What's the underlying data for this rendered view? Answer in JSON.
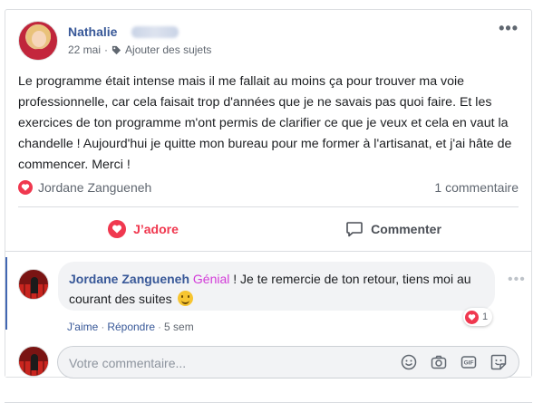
{
  "post": {
    "author": "Nathalie",
    "date": "22 mai",
    "separator": "·",
    "add_topics": "Ajouter des sujets",
    "more_icon": "more-horizontal-icon",
    "text": "Le programme était intense mais il me fallait au moins ça pour trouver ma voie professionnelle, car cela faisait trop d'années que je ne savais pas quoi faire. Et les exercices de ton programme m'ont permis de clarifier ce que je veux et cela en vaut la chandelle ! Aujourd'hui je quitte mon bureau pour me former à l'artisanat, et j'ai hâte de commencer. Merci !"
  },
  "reactions": {
    "icon": "love-reaction-icon",
    "names": "Jordane Zangueneh",
    "comment_count": "1 commentaire"
  },
  "actions": {
    "love_label": "J’adore",
    "comment_label": "Commenter"
  },
  "comment": {
    "author": "Jordane Zangueneh",
    "mention": "Génial",
    "text": " ! Je te remercie de ton retour, tiens moi au courant des suites",
    "emoji": "smiley-emoji",
    "reaction_count": "1",
    "like_link": "J'aime",
    "reply_link": "Répondre",
    "time": "5 sem",
    "sep": "·"
  },
  "composer": {
    "placeholder": "Votre commentaire...",
    "icons": [
      "emoji-icon",
      "camera-icon",
      "gif-icon",
      "sticker-icon"
    ]
  },
  "colors": {
    "link_blue": "#385898",
    "love_red": "#f0384f",
    "mention_pink": "#d23ad8",
    "thread_bar": "#4267b2"
  }
}
